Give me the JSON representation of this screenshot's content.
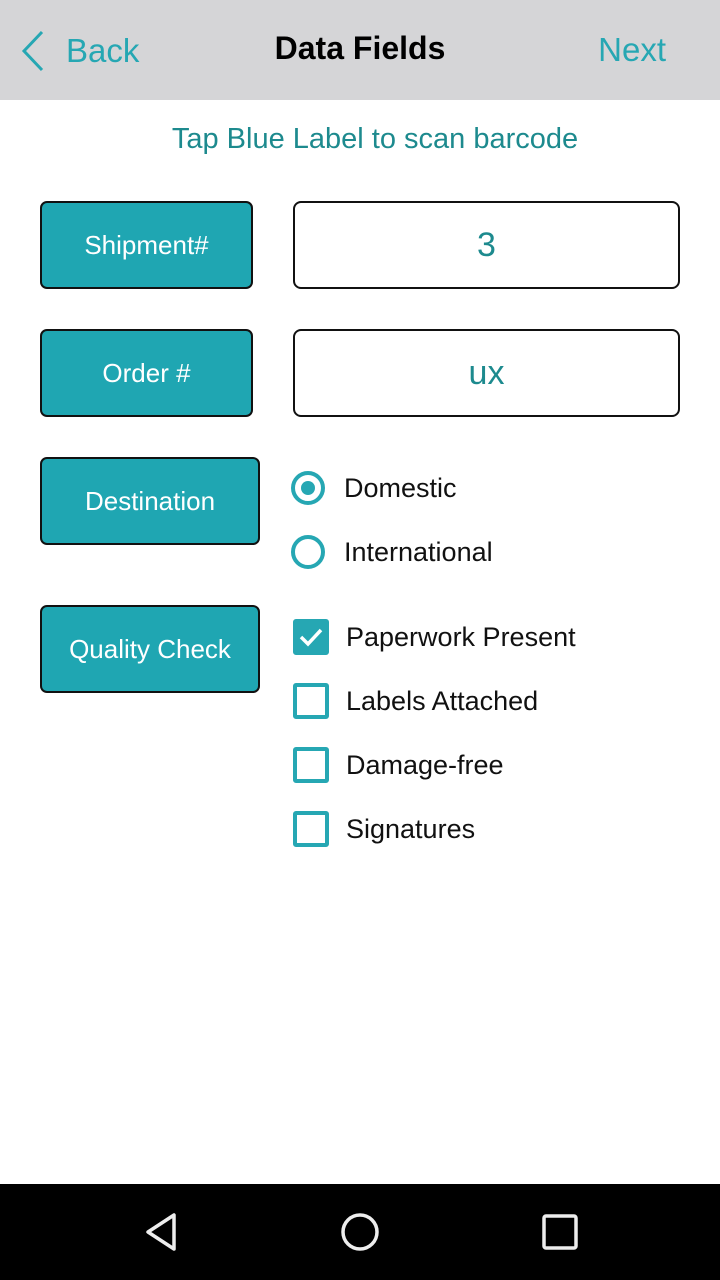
{
  "header": {
    "back_label": "Back",
    "title": "Data Fields",
    "next_label": "Next"
  },
  "hint": "Tap Blue Label to scan barcode",
  "fields": {
    "shipment": {
      "label": "Shipment#",
      "value": "3"
    },
    "order": {
      "label": "Order #",
      "value": "ux"
    }
  },
  "destination": {
    "label": "Destination",
    "options": [
      {
        "label": "Domestic",
        "selected": true
      },
      {
        "label": "International",
        "selected": false
      }
    ]
  },
  "quality_check": {
    "label": "Quality Check",
    "items": [
      {
        "label": "Paperwork Present",
        "checked": true
      },
      {
        "label": "Labels Attached",
        "checked": false
      },
      {
        "label": "Damage-free",
        "checked": false
      },
      {
        "label": "Signatures",
        "checked": false
      }
    ]
  },
  "colors": {
    "accent": "#26a7b3",
    "label_bg": "#1fa6b2",
    "value_text": "#1d8a8e",
    "header_bg": "#d5d5d7"
  },
  "nav_bar": {
    "buttons": [
      "back-icon",
      "home-icon",
      "recents-icon"
    ]
  }
}
